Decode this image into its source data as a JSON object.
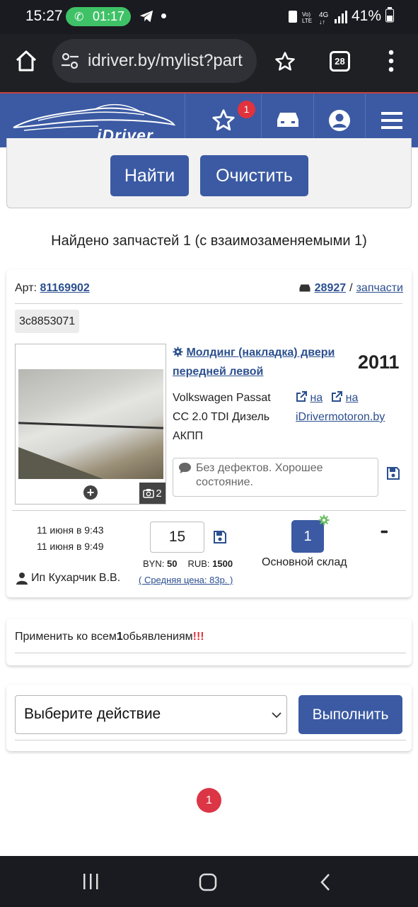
{
  "status_bar": {
    "time": "15:27",
    "call_timer": "01:17",
    "battery": "41%",
    "network": "4G"
  },
  "browser": {
    "url": "idriver.by/mylist?part",
    "tab_count": "28"
  },
  "site": {
    "logo_text": "iDriver",
    "favorites_badge": "1"
  },
  "search": {
    "find_label": "Найти",
    "clear_label": "Очистить"
  },
  "results_summary": "Найдено запчастей 1 (с взаимозаменяемыми 1)",
  "part": {
    "art_label": "Арт:",
    "art_number": "81169902",
    "car_id": "28927",
    "separator": "/",
    "parts_link": "запчасти",
    "oem_code": "3c8853071",
    "title": "Молдинг (накладка) двери передней левой",
    "year": "2011",
    "car_line1": "Volkswagen Passat",
    "car_line2": "CC 2.0 TDI Дизель",
    "car_line3": "АКПП",
    "link1_prefix": "на",
    "link1_site": "iDriver",
    "link2_prefix": "на",
    "link2_site": "motoron.by",
    "photo_count": "2",
    "description": "Без дефектов. Хорошее состояние.",
    "date_created": "11 июня в 9:43",
    "date_updated": "11 июня в 9:49",
    "price_value": "15",
    "byn_label": "BYN:",
    "byn_value": "50",
    "rub_label": "RUB:",
    "rub_value": "1500",
    "avg_price": "( Средняя цена: 83р. )",
    "stock_count": "1",
    "warehouse": "Основной склад",
    "seller": "Ип Кухарчик В.В.",
    "more_label": "•••"
  },
  "apply_all": {
    "prefix": "Применить ко всем",
    "count": "1",
    "suffix": "обьявлениям",
    "exclaim": "!!!"
  },
  "bulk_action": {
    "selected": "Выберите действие",
    "execute_label": "Выполнить"
  },
  "pagination": {
    "current": "1"
  },
  "colors": {
    "brand_blue": "#3b5aa3",
    "link_blue": "#2b4f8f",
    "badge_red": "#e0333d",
    "call_green": "#3fc267"
  }
}
